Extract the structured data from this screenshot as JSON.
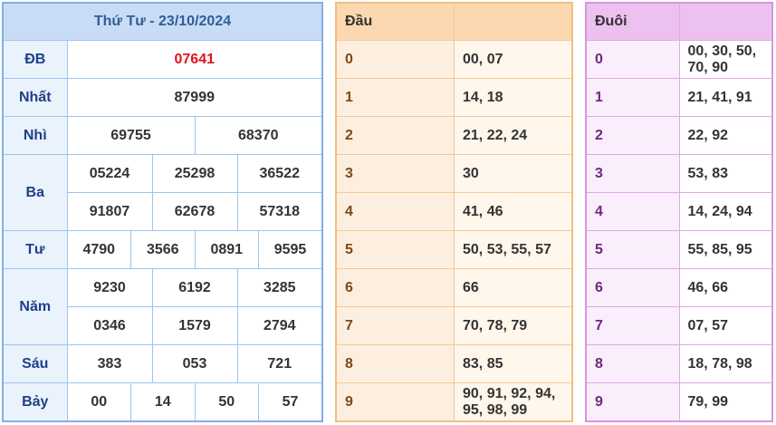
{
  "prize_table": {
    "title": "Thứ Tư - 23/10/2024",
    "rows": [
      {
        "label": "ĐB",
        "values": [
          "07641"
        ]
      },
      {
        "label": "Nhất",
        "values": [
          "87999"
        ]
      },
      {
        "label": "Nhì",
        "values": [
          "69755",
          "68370"
        ]
      },
      {
        "label": "Ba",
        "values": [
          "05224",
          "25298",
          "36522",
          "91807",
          "62678",
          "57318"
        ]
      },
      {
        "label": "Tư",
        "values": [
          "4790",
          "3566",
          "0891",
          "9595"
        ]
      },
      {
        "label": "Năm",
        "values": [
          "9230",
          "6192",
          "3285",
          "0346",
          "1579",
          "2794"
        ]
      },
      {
        "label": "Sáu",
        "values": [
          "383",
          "053",
          "721"
        ]
      },
      {
        "label": "Bảy",
        "values": [
          "00",
          "14",
          "50",
          "57"
        ]
      }
    ]
  },
  "dau_table": {
    "title": "Đầu",
    "rows": [
      {
        "key": "0",
        "value": "00, 07"
      },
      {
        "key": "1",
        "value": "14, 18"
      },
      {
        "key": "2",
        "value": "21, 22, 24"
      },
      {
        "key": "3",
        "value": "30"
      },
      {
        "key": "4",
        "value": "41, 46"
      },
      {
        "key": "5",
        "value": "50, 53, 55, 57"
      },
      {
        "key": "6",
        "value": "66"
      },
      {
        "key": "7",
        "value": "70, 78, 79"
      },
      {
        "key": "8",
        "value": "83, 85"
      },
      {
        "key": "9",
        "value": "90, 91, 92, 94, 95, 98, 99"
      }
    ]
  },
  "duoi_table": {
    "title": "Đuôi",
    "rows": [
      {
        "key": "0",
        "value": "00, 30, 50, 70, 90"
      },
      {
        "key": "1",
        "value": "21, 41, 91"
      },
      {
        "key": "2",
        "value": "22, 92"
      },
      {
        "key": "3",
        "value": "53, 83"
      },
      {
        "key": "4",
        "value": "14, 24, 94"
      },
      {
        "key": "5",
        "value": "55, 85, 95"
      },
      {
        "key": "6",
        "value": "46, 66"
      },
      {
        "key": "7",
        "value": "07, 57"
      },
      {
        "key": "8",
        "value": "18, 78, 98"
      },
      {
        "key": "9",
        "value": "79, 99"
      }
    ]
  },
  "colors": {
    "prize_header": "#c9dcf5",
    "special_prize_text": "#e0141e",
    "dau_header": "#fbd8b0",
    "duoi_header": "#ecc1ef"
  }
}
